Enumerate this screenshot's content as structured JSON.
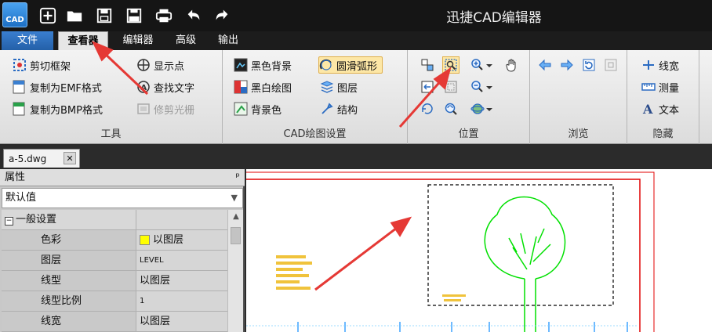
{
  "app": {
    "title": "迅捷CAD编辑器",
    "logo_text": "CAD"
  },
  "quick_access": [
    {
      "name": "new-icon"
    },
    {
      "name": "open-folder-icon"
    },
    {
      "name": "save-icon"
    },
    {
      "name": "save-pdf-icon"
    },
    {
      "name": "print-icon"
    },
    {
      "name": "undo-icon"
    },
    {
      "name": "redo-icon"
    }
  ],
  "menu": {
    "tabs": [
      "文件",
      "查看器",
      "编辑器",
      "高级",
      "输出"
    ],
    "active": "查看器"
  },
  "ribbon": {
    "tools": {
      "label": "工具",
      "buttons": [
        "剪切框架",
        "复制为EMF格式",
        "复制为BMP格式",
        "显示点",
        "查找文字",
        "修剪光栅"
      ]
    },
    "cad_settings": {
      "label": "CAD绘图设置",
      "buttons": [
        "黑色背景",
        "黑白绘图",
        "背景色",
        "圆滑弧形",
        "图层",
        "结构"
      ]
    },
    "position": {
      "label": "位置"
    },
    "browse": {
      "label": "浏览"
    },
    "hide": {
      "label": "隐藏",
      "buttons": [
        "线宽",
        "测量",
        "文本"
      ]
    }
  },
  "document": {
    "tab_name": "a-5.dwg",
    "close_glyph": "✕"
  },
  "properties": {
    "title": "属性",
    "pin_glyph": "ᵖ",
    "selector": "默认值",
    "section": "一般设置",
    "rows": [
      {
        "name": "色彩",
        "value": "以图层",
        "swatch": "#ffff00"
      },
      {
        "name": "图层",
        "value": "LEVEL"
      },
      {
        "name": "线型",
        "value": "以图层"
      },
      {
        "name": "线型比例",
        "value": "1"
      },
      {
        "name": "线宽",
        "value": "以图层"
      }
    ]
  },
  "colors": {
    "accent": "#2460a8",
    "annotation": "#e53935",
    "cad_green": "#00e000",
    "frame_red": "#e00000"
  }
}
